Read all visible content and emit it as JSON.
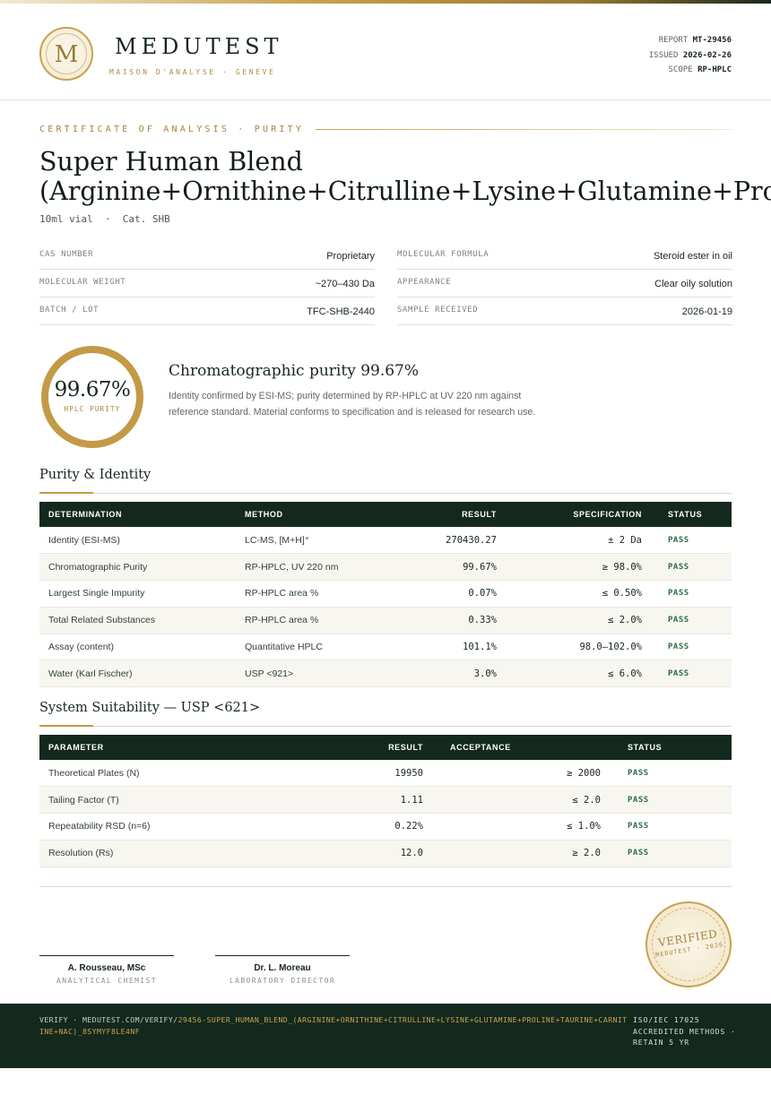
{
  "header": {
    "logo_letter": "M",
    "brand_name": "MEDUTEST",
    "brand_subtitle": "MAISON D'ANALYSE · GENÈVE",
    "report_label": "REPORT",
    "report_value": "MT-29456",
    "issued_label": "ISSUED",
    "issued_value": "2026-02-26",
    "scope_label": "SCOPE",
    "scope_value": "RP-HPLC"
  },
  "certificate": {
    "eyebrow": "CERTIFICATE OF ANALYSIS · PURITY",
    "title_line1": "Super Human Blend",
    "title_line2": "(Arginine+Ornithine+Citrulline+Lysine+Glutamine+Proline+Taurine+Carnitine+NAC)",
    "subtitle": "10ml vial  ·  Cat. SHB"
  },
  "specs": {
    "left": [
      {
        "key": "CAS NUMBER",
        "value": "Proprietary"
      },
      {
        "key": "MOLECULAR WEIGHT",
        "value": "~270–430 Da"
      },
      {
        "key": "BATCH / LOT",
        "value": "TFC-SHB-2440"
      }
    ],
    "right": [
      {
        "key": "MOLECULAR FORMULA",
        "value": "Steroid ester in oil"
      },
      {
        "key": "APPEARANCE",
        "value": "Clear oily solution"
      },
      {
        "key": "SAMPLE RECEIVED",
        "value": "2026-01-19"
      }
    ]
  },
  "purity": {
    "value": "99.67%",
    "label": "HPLC PURITY",
    "headline": "Chromatographic purity 99.67%",
    "description": "Identity confirmed by ESI-MS; purity determined by RP-HPLC at UV 220 nm against reference standard. Material conforms to specification and is released for research use."
  },
  "purity_identity": {
    "title": "Purity & Identity",
    "headers": [
      "DETERMINATION",
      "METHOD",
      "RESULT",
      "SPECIFICATION",
      "STATUS"
    ],
    "rows": [
      {
        "determination": "Identity (ESI-MS)",
        "method": "LC-MS, [M+H]⁺",
        "result": "270430.27",
        "spec": "± 2 Da",
        "status": "PASS"
      },
      {
        "determination": "Chromatographic Purity",
        "method": "RP-HPLC, UV 220 nm",
        "result": "99.67%",
        "spec": "≥ 98.0%",
        "status": "PASS"
      },
      {
        "determination": "Largest Single Impurity",
        "method": "RP-HPLC area %",
        "result": "0.07%",
        "spec": "≤ 0.50%",
        "status": "PASS"
      },
      {
        "determination": "Total Related Substances",
        "method": "RP-HPLC area %",
        "result": "0.33%",
        "spec": "≤ 2.0%",
        "status": "PASS"
      },
      {
        "determination": "Assay (content)",
        "method": "Quantitative HPLC",
        "result": "101.1%",
        "spec": "98.0–102.0%",
        "status": "PASS"
      },
      {
        "determination": "Water (Karl Fischer)",
        "method": "USP <921>",
        "result": "3.0%",
        "spec": "≤ 6.0%",
        "status": "PASS"
      }
    ]
  },
  "system_suitability": {
    "title": "System Suitability — USP <621>",
    "headers": [
      "PARAMETER",
      "RESULT",
      "ACCEPTANCE",
      "STATUS"
    ],
    "rows": [
      {
        "parameter": "Theoretical Plates (N)",
        "result": "19950",
        "acceptance": "≥ 2000",
        "status": "PASS"
      },
      {
        "parameter": "Tailing Factor (T)",
        "result": "1.11",
        "acceptance": "≤ 2.0",
        "status": "PASS"
      },
      {
        "parameter": "Repeatability RSD (n=6)",
        "result": "0.22%",
        "acceptance": "≤ 1.0%",
        "status": "PASS"
      },
      {
        "parameter": "Resolution (Rs)",
        "result": "12.0",
        "acceptance": "≥ 2.0",
        "status": "PASS"
      }
    ]
  },
  "signatures": [
    {
      "name": "A. Rousseau, MSc",
      "role": "ANALYTICAL CHEMIST"
    },
    {
      "name": "Dr. L. Moreau",
      "role": "LABORATORY DIRECTOR"
    }
  ],
  "seal": {
    "word": "VERIFIED",
    "sub": "MEDUTEST · 2026"
  },
  "footer": {
    "verify_lead": "VERIFY · MEDUTEST.COM/VERIFY/",
    "verify_code": "29456-SUPER_HUMAN_BLEND_(ARGININE+ORNITHINE+CITRULLINE+LYSINE+GLUTAMINE+PROLINE+TAURINE+CARNITINE+NAC)_8SYMYF8LE4NF",
    "accreditation": "ISO/IEC 17025 ACCREDITED METHODS · RETAIN 5 YR"
  },
  "colors": {
    "accent_gold": "#c39a45",
    "dark_green": "#14291e",
    "pass_green": "#2f6b4a"
  }
}
